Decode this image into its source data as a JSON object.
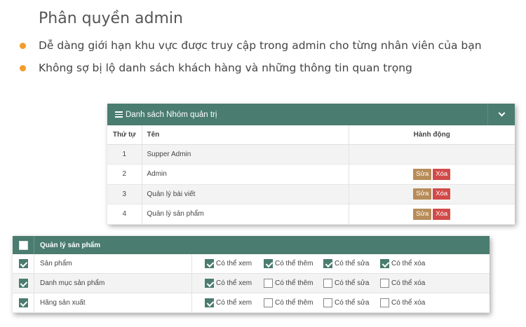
{
  "heading": "Phân quyền admin",
  "bullets": [
    "Dễ dàng giới hạn khu vực được truy cập trong admin cho từng nhân viên của bạn",
    "Không sợ bị lộ danh sách khách hàng và những thông tin quan trọng"
  ],
  "colors": {
    "header": "#4a7c6f",
    "bullet": "#f39c2a",
    "edit": "#b78c59",
    "delete": "#d14a48"
  },
  "group_panel": {
    "title": "Danh sách Nhóm quản trị",
    "columns": [
      "Thứ tự",
      "Tên",
      "Hành động"
    ],
    "edit_label": "Sửa",
    "delete_label": "Xóa",
    "rows": [
      {
        "order": "1",
        "name": "Supper Admin",
        "actions": false
      },
      {
        "order": "2",
        "name": "Admin",
        "actions": true
      },
      {
        "order": "3",
        "name": "Quản lý bài viết",
        "actions": true
      },
      {
        "order": "4",
        "name": "Quản lý sản phẩm",
        "actions": true
      }
    ]
  },
  "perm_panel": {
    "title": "Quản lý sản phẩm",
    "header_checked": false,
    "perm_labels": [
      "Có thể xem",
      "Có thể thêm",
      "Có thể sửa",
      "Có thể xóa"
    ],
    "rows": [
      {
        "name": "Sản phẩm",
        "checked": true,
        "perms": [
          true,
          true,
          true,
          true
        ]
      },
      {
        "name": "Danh mục sản phẩm",
        "checked": true,
        "perms": [
          true,
          false,
          false,
          false
        ]
      },
      {
        "name": "Hãng sản xuất",
        "checked": true,
        "perms": [
          true,
          false,
          false,
          false
        ]
      }
    ]
  }
}
